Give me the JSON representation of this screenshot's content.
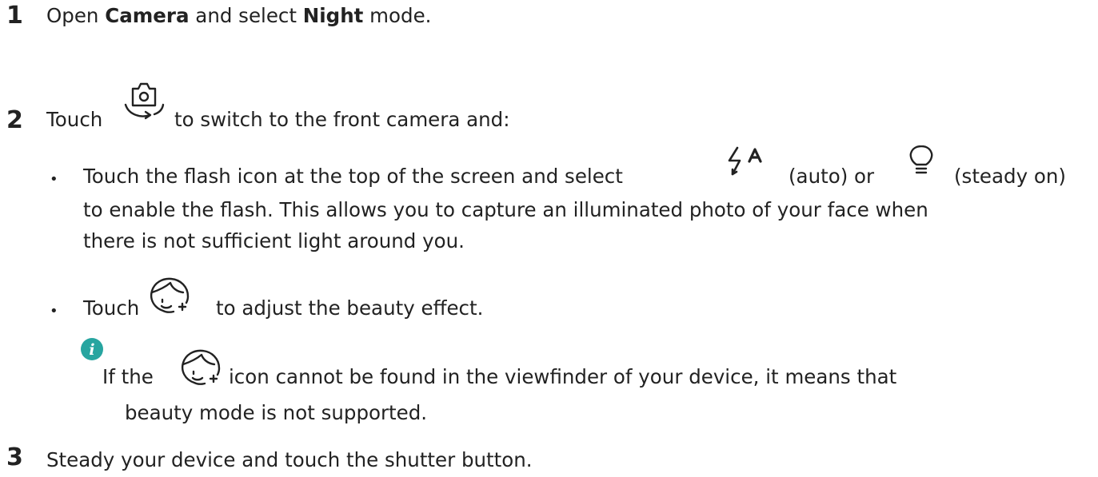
{
  "steps": [
    {
      "number": "1",
      "text_before": "Open ",
      "bold_1": "Camera",
      "text_middle": " and select ",
      "bold_2": "Night",
      "text_after": " mode."
    },
    {
      "number": "2",
      "text_before": "Touch",
      "text_after": "to switch to the front camera and:",
      "bullets": [
        {
          "line1_before": "Touch the flash icon at the top of the screen and select",
          "line1_auto": "(auto) or",
          "line1_steady": "(steady on)",
          "line2": "to enable the flash. This allows you to capture an illuminated photo of your face when",
          "line3": "there is not sufficient light around you."
        },
        {
          "text_before": "Touch",
          "text_after": "to adjust the beauty effect."
        }
      ],
      "note": {
        "icon": "info-icon",
        "line1_before": "If the",
        "line1_after": "icon cannot be found in the viewfinder of your device, it means that",
        "line2": "beauty mode is not supported."
      }
    },
    {
      "number": "3",
      "text": "Steady your device and touch the shutter button."
    }
  ],
  "icons": {
    "switch_camera": "switch-camera-icon",
    "flash_auto": "flash-auto-icon",
    "flash_steady": "flash-steady-icon",
    "beauty": "beauty-icon"
  },
  "colors": {
    "text": "#222222",
    "info_accent": "#27a5a0"
  }
}
